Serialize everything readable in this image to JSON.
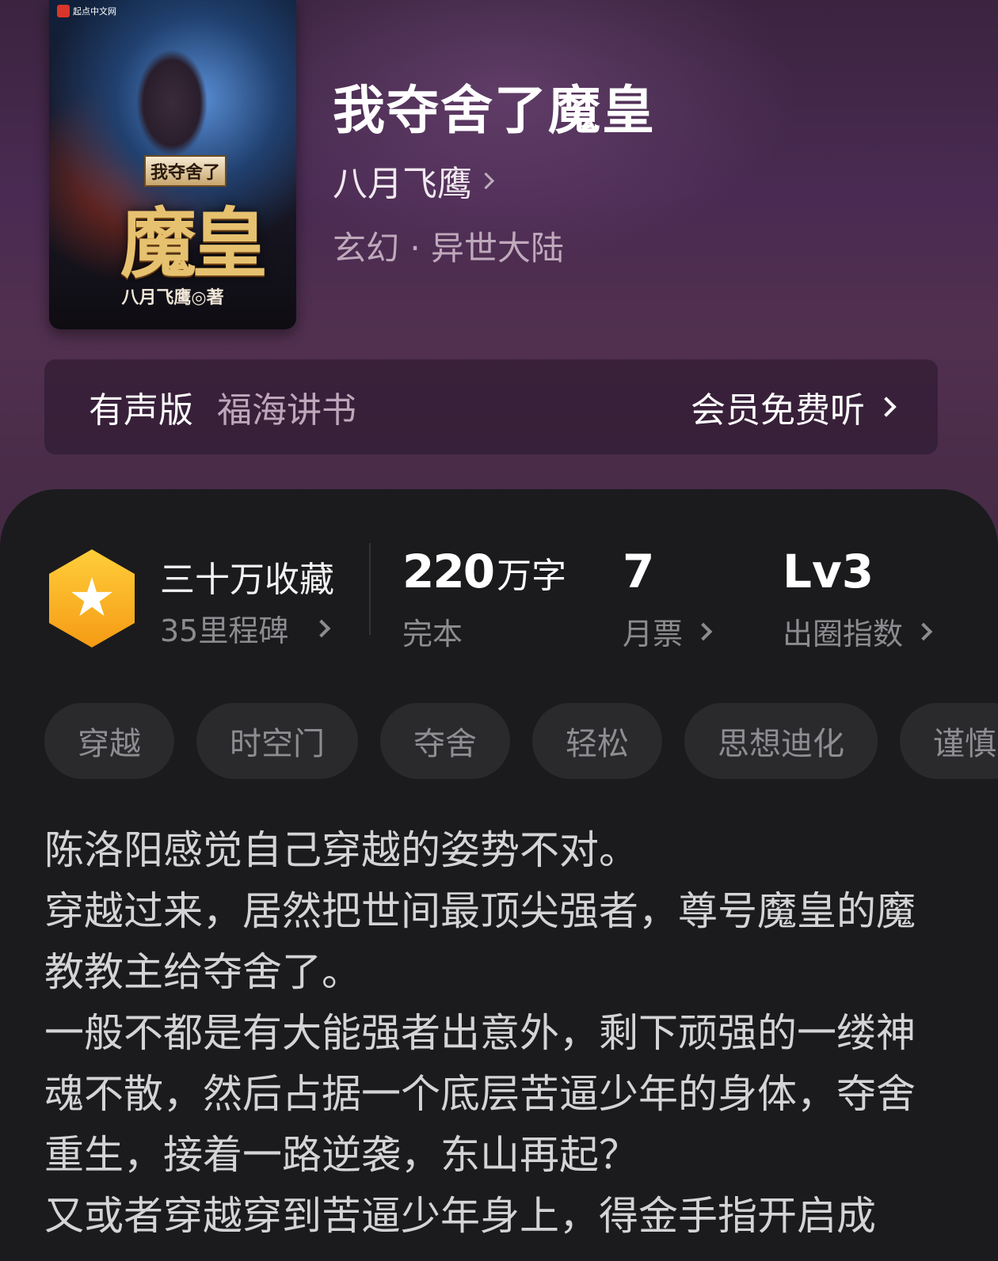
{
  "book": {
    "title": "我夺舍了魔皇",
    "author": "八月飞鹰",
    "genre": "玄幻 · 异世大陆",
    "cover": {
      "publisher_badge": "起点中文网",
      "subtitle": "我夺舍了",
      "big_title": "魔皇",
      "author_line": "八月飞鹰◎著"
    }
  },
  "audio": {
    "label": "有声版",
    "narrator": "福海讲书",
    "cta": "会员免费听"
  },
  "stats": {
    "favorites": "三十万收藏",
    "milestones": "35里程碑",
    "words_num": "220",
    "words_unit": "万字",
    "status": "完本",
    "monthly_tickets": "7",
    "monthly_tickets_label": "月票",
    "level": "Lv3",
    "level_label": "出圈指数"
  },
  "tags": [
    "穿越",
    "时空门",
    "夺舍",
    "轻松",
    "思想迪化",
    "谨慎"
  ],
  "description": [
    "陈洛阳感觉自己穿越的姿势不对。",
    "穿越过来，居然把世间最顶尖强者，尊号魔皇的魔教教主给夺舍了。",
    "一般不都是有大能强者出意外，剩下顽强的一缕神魂不散，然后占据一个底层苦逼少年的身体，夺舍重生，接着一路逆袭，东山再起？",
    "又或者穿越穿到苦逼少年身上，得金手指开启成"
  ],
  "colors": {
    "hero_bg": "#4a2a52",
    "sheet_bg": "#1b1b1d",
    "badge_gold": "#f5a91e",
    "tag_bg": "#2a2a2d"
  },
  "icons": [
    "chevron-right-icon",
    "star-badge-icon"
  ]
}
